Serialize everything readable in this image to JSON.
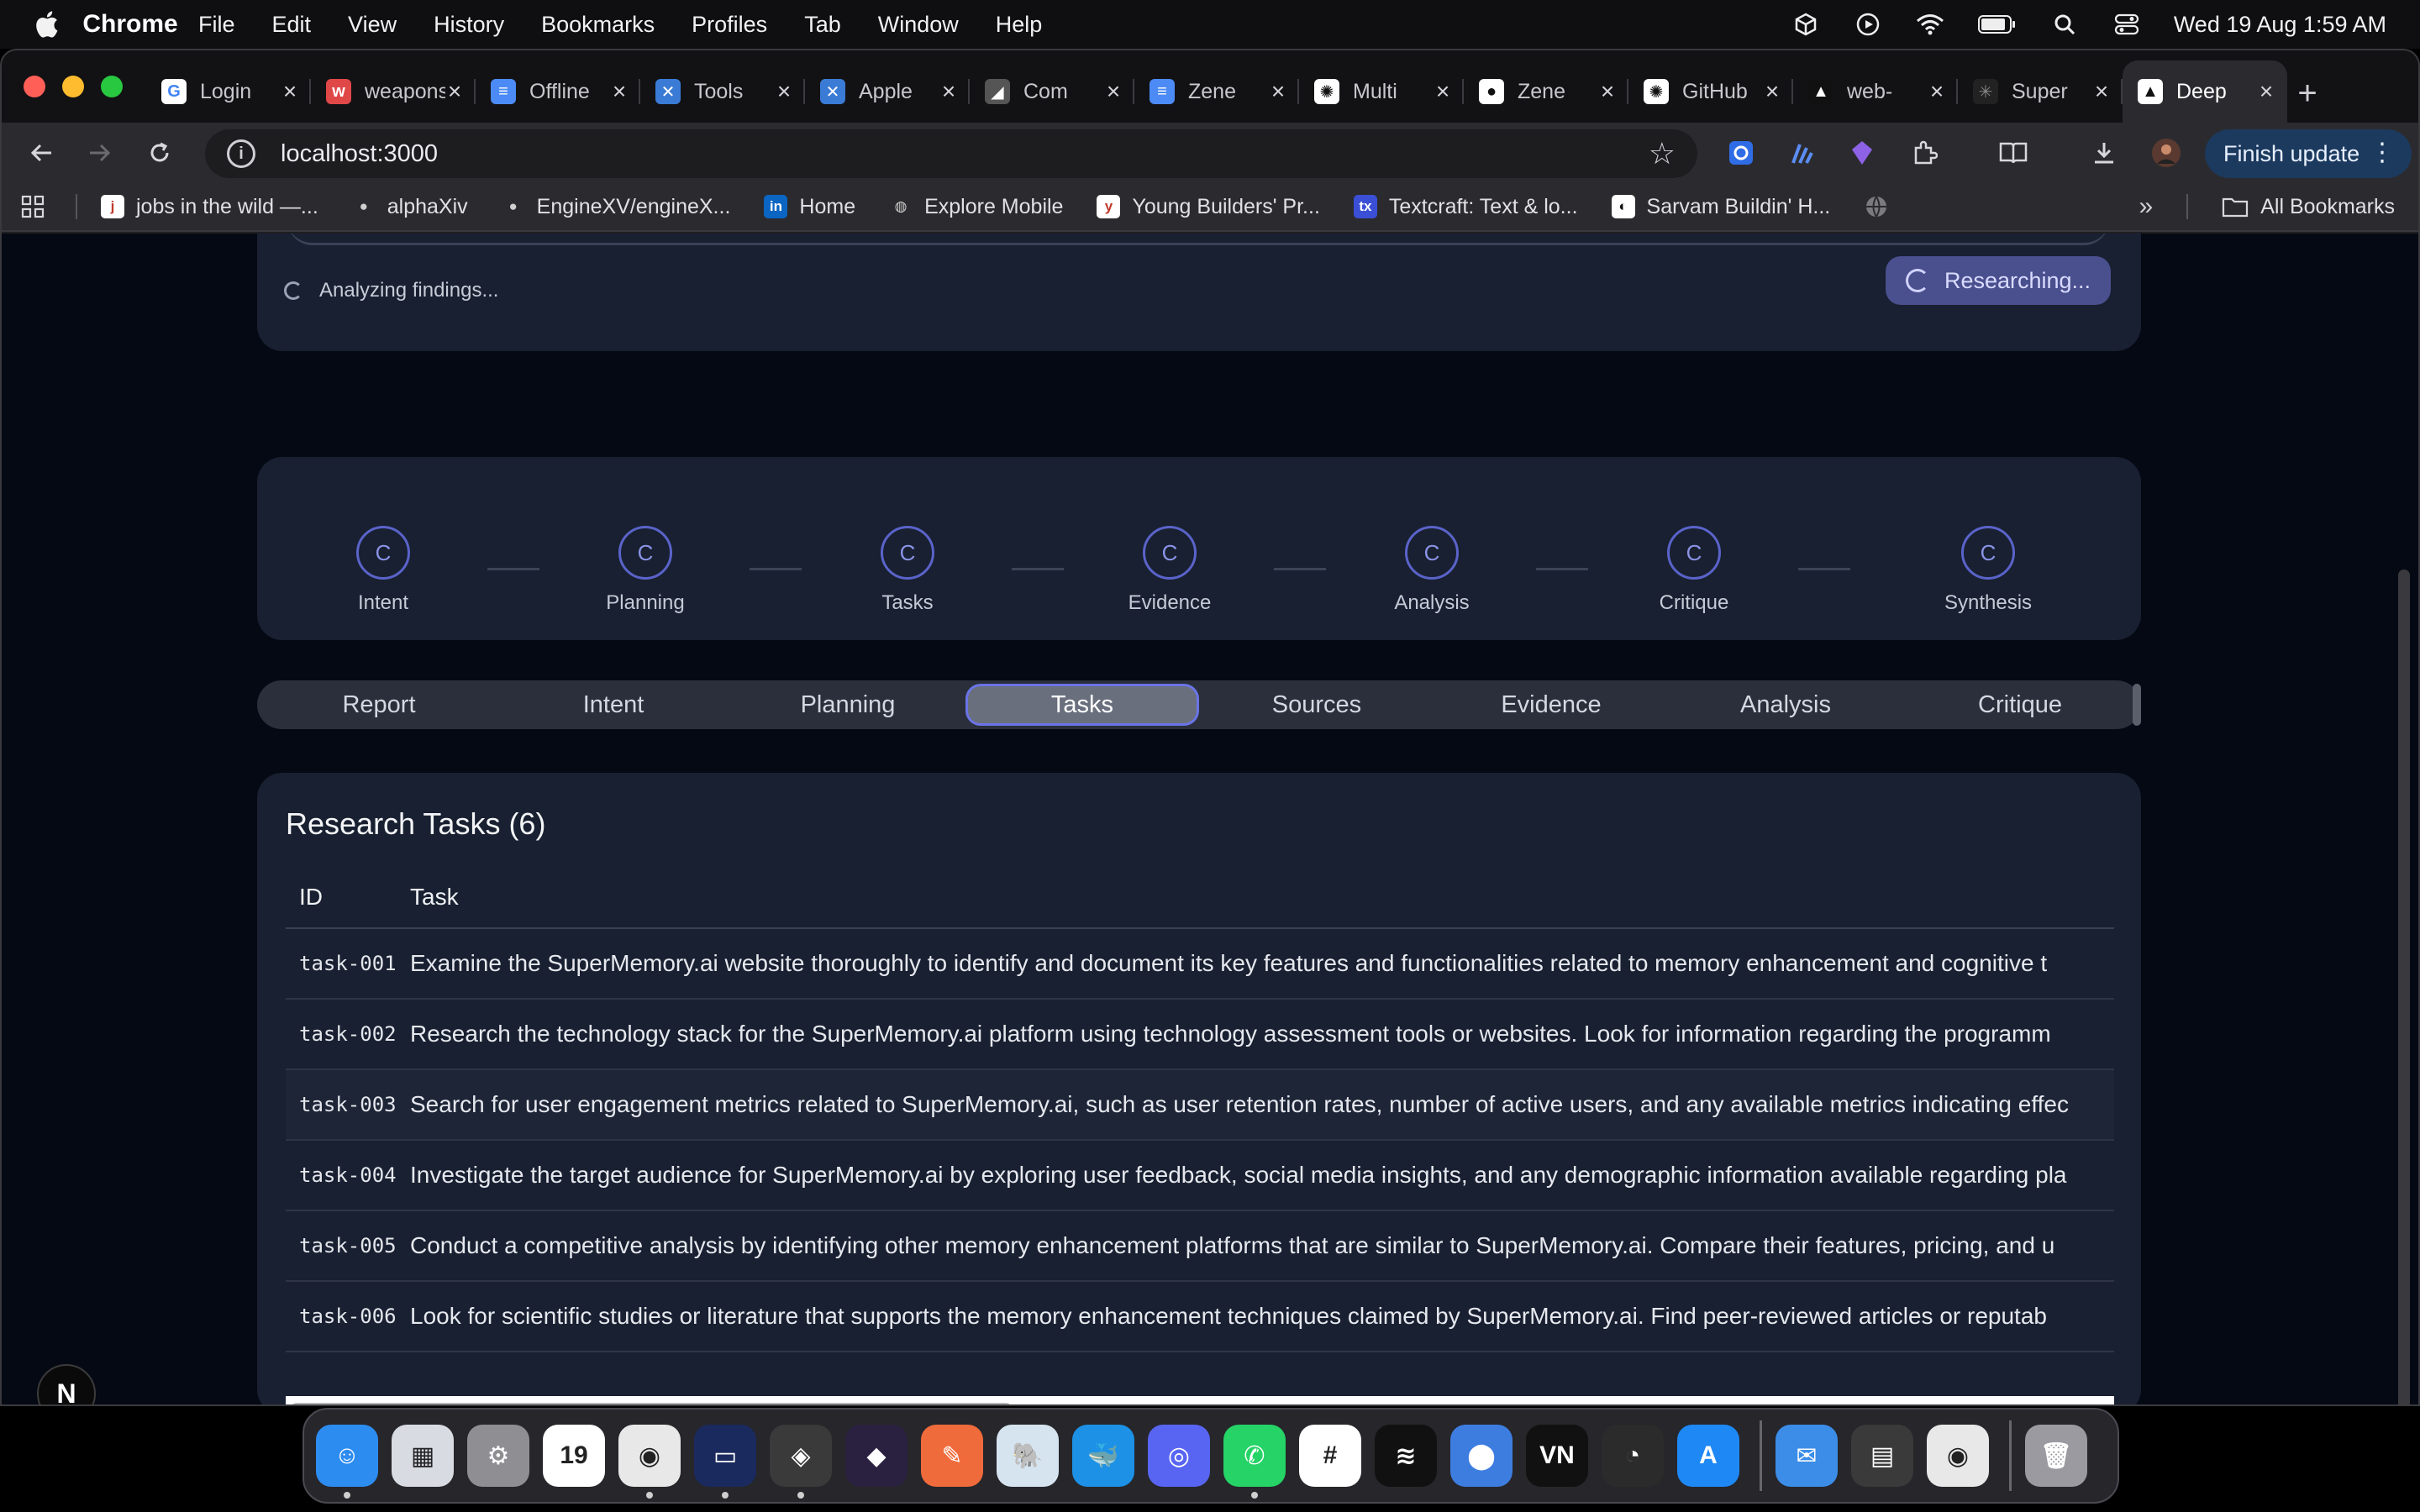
{
  "menubar": {
    "app": "Chrome",
    "items": [
      "File",
      "Edit",
      "View",
      "History",
      "Bookmarks",
      "Profiles",
      "Tab",
      "Window",
      "Help"
    ],
    "clock": "Wed 19 Aug  1:59 AM"
  },
  "tabs": [
    {
      "title": "Login",
      "color": "#ffffff",
      "glyph": "G",
      "fg": "#4285f4"
    },
    {
      "title": "weapons",
      "color": "#e04848",
      "glyph": "w",
      "fg": "#fff"
    },
    {
      "title": "Offline",
      "color": "#4c8bf5",
      "glyph": "≡",
      "fg": "#fff"
    },
    {
      "title": "Tools",
      "color": "#3a7bd5",
      "glyph": "✕",
      "fg": "#fff"
    },
    {
      "title": "Apple",
      "color": "#3a7bd5",
      "glyph": "✕",
      "fg": "#fff"
    },
    {
      "title": "Com",
      "color": "#555555",
      "glyph": "◢",
      "fg": "#fff"
    },
    {
      "title": "Zene",
      "color": "#4c8bf5",
      "glyph": "≡",
      "fg": "#fff"
    },
    {
      "title": "Multi",
      "color": "#ffffff",
      "glyph": "✺",
      "fg": "#111"
    },
    {
      "title": "Zene",
      "color": "#ffffff",
      "glyph": "●",
      "fg": "#111"
    },
    {
      "title": "GitHub",
      "color": "#ffffff",
      "glyph": "✺",
      "fg": "#111"
    },
    {
      "title": "web-",
      "color": "#111111",
      "glyph": "▲",
      "fg": "#fff"
    },
    {
      "title": "Super",
      "color": "#222222",
      "glyph": "✳",
      "fg": "#888"
    },
    {
      "title": "Deep",
      "color": "#ffffff",
      "glyph": "▲",
      "fg": "#111"
    }
  ],
  "omnibox": {
    "url": "localhost:3000"
  },
  "finish_update": "Finish update",
  "bookmarks": [
    {
      "label": "jobs in the wild —...",
      "color": "#ffffff",
      "glyph": "j",
      "fg": "#c0392b"
    },
    {
      "label": "alphaXiv",
      "color": "#2b2b2f",
      "glyph": "●",
      "fg": "#cfcfcf"
    },
    {
      "label": "EngineXV/engineX...",
      "color": "#2b2b2f",
      "glyph": "●",
      "fg": "#cfcfcf"
    },
    {
      "label": "Home",
      "color": "#0a66c2",
      "glyph": "in",
      "fg": "#fff"
    },
    {
      "label": "Explore Mobile",
      "color": "#2b2b2f",
      "glyph": "◍",
      "fg": "#cfcfcf"
    },
    {
      "label": "Young Builders' Pr...",
      "color": "#ffffff",
      "glyph": "y",
      "fg": "#c0392b"
    },
    {
      "label": "Textcraft: Text & lo...",
      "color": "#3a4fd6",
      "glyph": "tx",
      "fg": "#fff"
    },
    {
      "label": "Sarvam Buildin' H...",
      "color": "#ffffff",
      "glyph": "◐",
      "fg": "#111"
    }
  ],
  "all_bookmarks": "All Bookmarks",
  "research": {
    "status_text": "Analyzing findings...",
    "button_label": "Researching..."
  },
  "stages": [
    {
      "label": "Intent",
      "glyph": "C"
    },
    {
      "label": "Planning",
      "glyph": "C"
    },
    {
      "label": "Tasks",
      "glyph": "C"
    },
    {
      "label": "Evidence",
      "glyph": "C"
    },
    {
      "label": "Analysis",
      "glyph": "C"
    },
    {
      "label": "Critique",
      "glyph": "C"
    },
    {
      "label": "Synthesis",
      "glyph": "C"
    }
  ],
  "page_tabs": [
    {
      "label": "Report",
      "active": false
    },
    {
      "label": "Intent",
      "active": false
    },
    {
      "label": "Planning",
      "active": false
    },
    {
      "label": "Tasks",
      "active": true
    },
    {
      "label": "Sources",
      "active": false
    },
    {
      "label": "Evidence",
      "active": false
    },
    {
      "label": "Analysis",
      "active": false
    },
    {
      "label": "Critique",
      "active": false
    }
  ],
  "tasks_panel": {
    "title": "Research Tasks (6)",
    "columns": [
      "ID",
      "Task"
    ],
    "rows": [
      {
        "id": "task-001",
        "task": "Examine the SuperMemory.ai website thoroughly to identify and document its key features and functionalities related to memory enhancement and cognitive t"
      },
      {
        "id": "task-002",
        "task": "Research the technology stack for the SuperMemory.ai platform using technology assessment tools or websites. Look for information regarding the programm"
      },
      {
        "id": "task-003",
        "task": "Search for user engagement metrics related to SuperMemory.ai, such as user retention rates, number of active users, and any available metrics indicating effec"
      },
      {
        "id": "task-004",
        "task": "Investigate the target audience for SuperMemory.ai by exploring user feedback, social media insights, and any demographic information available regarding pla"
      },
      {
        "id": "task-005",
        "task": "Conduct a competitive analysis by identifying other memory enhancement platforms that are similar to SuperMemory.ai. Compare their features, pricing, and u"
      },
      {
        "id": "task-006",
        "task": "Look for scientific studies or literature that supports the memory enhancement techniques claimed by SuperMemory.ai. Find peer-reviewed articles or reputab"
      }
    ]
  },
  "next_badge": "N",
  "dock": [
    {
      "name": "finder",
      "color": "#2d8cf0",
      "glyph": "☺",
      "running": true
    },
    {
      "name": "launchpad",
      "color": "#d9dbe2",
      "glyph": "▦",
      "running": false
    },
    {
      "name": "system-settings",
      "color": "#8e8e93",
      "glyph": "⚙",
      "running": false
    },
    {
      "name": "calendar",
      "color": "#ffffff",
      "glyph": "19",
      "running": false
    },
    {
      "name": "chrome",
      "color": "#e8e8e8",
      "glyph": "◉",
      "running": true
    },
    {
      "name": "terminal-app",
      "color": "#1b2a5e",
      "glyph": "▭",
      "running": true
    },
    {
      "name": "cube-app",
      "color": "#3a3a3a",
      "glyph": "◈",
      "running": true
    },
    {
      "name": "obsidian",
      "color": "#2a2140",
      "glyph": "◆",
      "running": false
    },
    {
      "name": "paw-app",
      "color": "#f06b3b",
      "glyph": "✎",
      "running": false
    },
    {
      "name": "postgres",
      "color": "#d6e4f0",
      "glyph": "🐘",
      "running": false
    },
    {
      "name": "docker",
      "color": "#1d91e6",
      "glyph": "🐳",
      "running": false
    },
    {
      "name": "discord",
      "color": "#5865f2",
      "glyph": "◎",
      "running": false
    },
    {
      "name": "whatsapp",
      "color": "#25d366",
      "glyph": "✆",
      "running": true
    },
    {
      "name": "slack",
      "color": "#ffffff",
      "glyph": "#",
      "running": false
    },
    {
      "name": "spotify",
      "color": "#111111",
      "glyph": "≋",
      "running": false
    },
    {
      "name": "db-app",
      "color": "#3e7de0",
      "glyph": "⬤",
      "running": false
    },
    {
      "name": "vn-app",
      "color": "#111111",
      "glyph": "VN",
      "running": false
    },
    {
      "name": "obs",
      "color": "#2b2b2b",
      "glyph": "◔",
      "running": false
    },
    {
      "name": "app-store",
      "color": "#1e88f5",
      "glyph": "A",
      "running": false
    },
    {
      "name": "mail",
      "color": "#3b8de8",
      "glyph": "✉",
      "running": false
    },
    {
      "name": "calculator",
      "color": "#3a3a3a",
      "glyph": "▤",
      "running": false
    },
    {
      "name": "chrome-2",
      "color": "#e8e8e8",
      "glyph": "◉",
      "running": false
    },
    {
      "name": "trash",
      "color": "#9a9aa0",
      "glyph": "🗑",
      "running": false
    }
  ]
}
